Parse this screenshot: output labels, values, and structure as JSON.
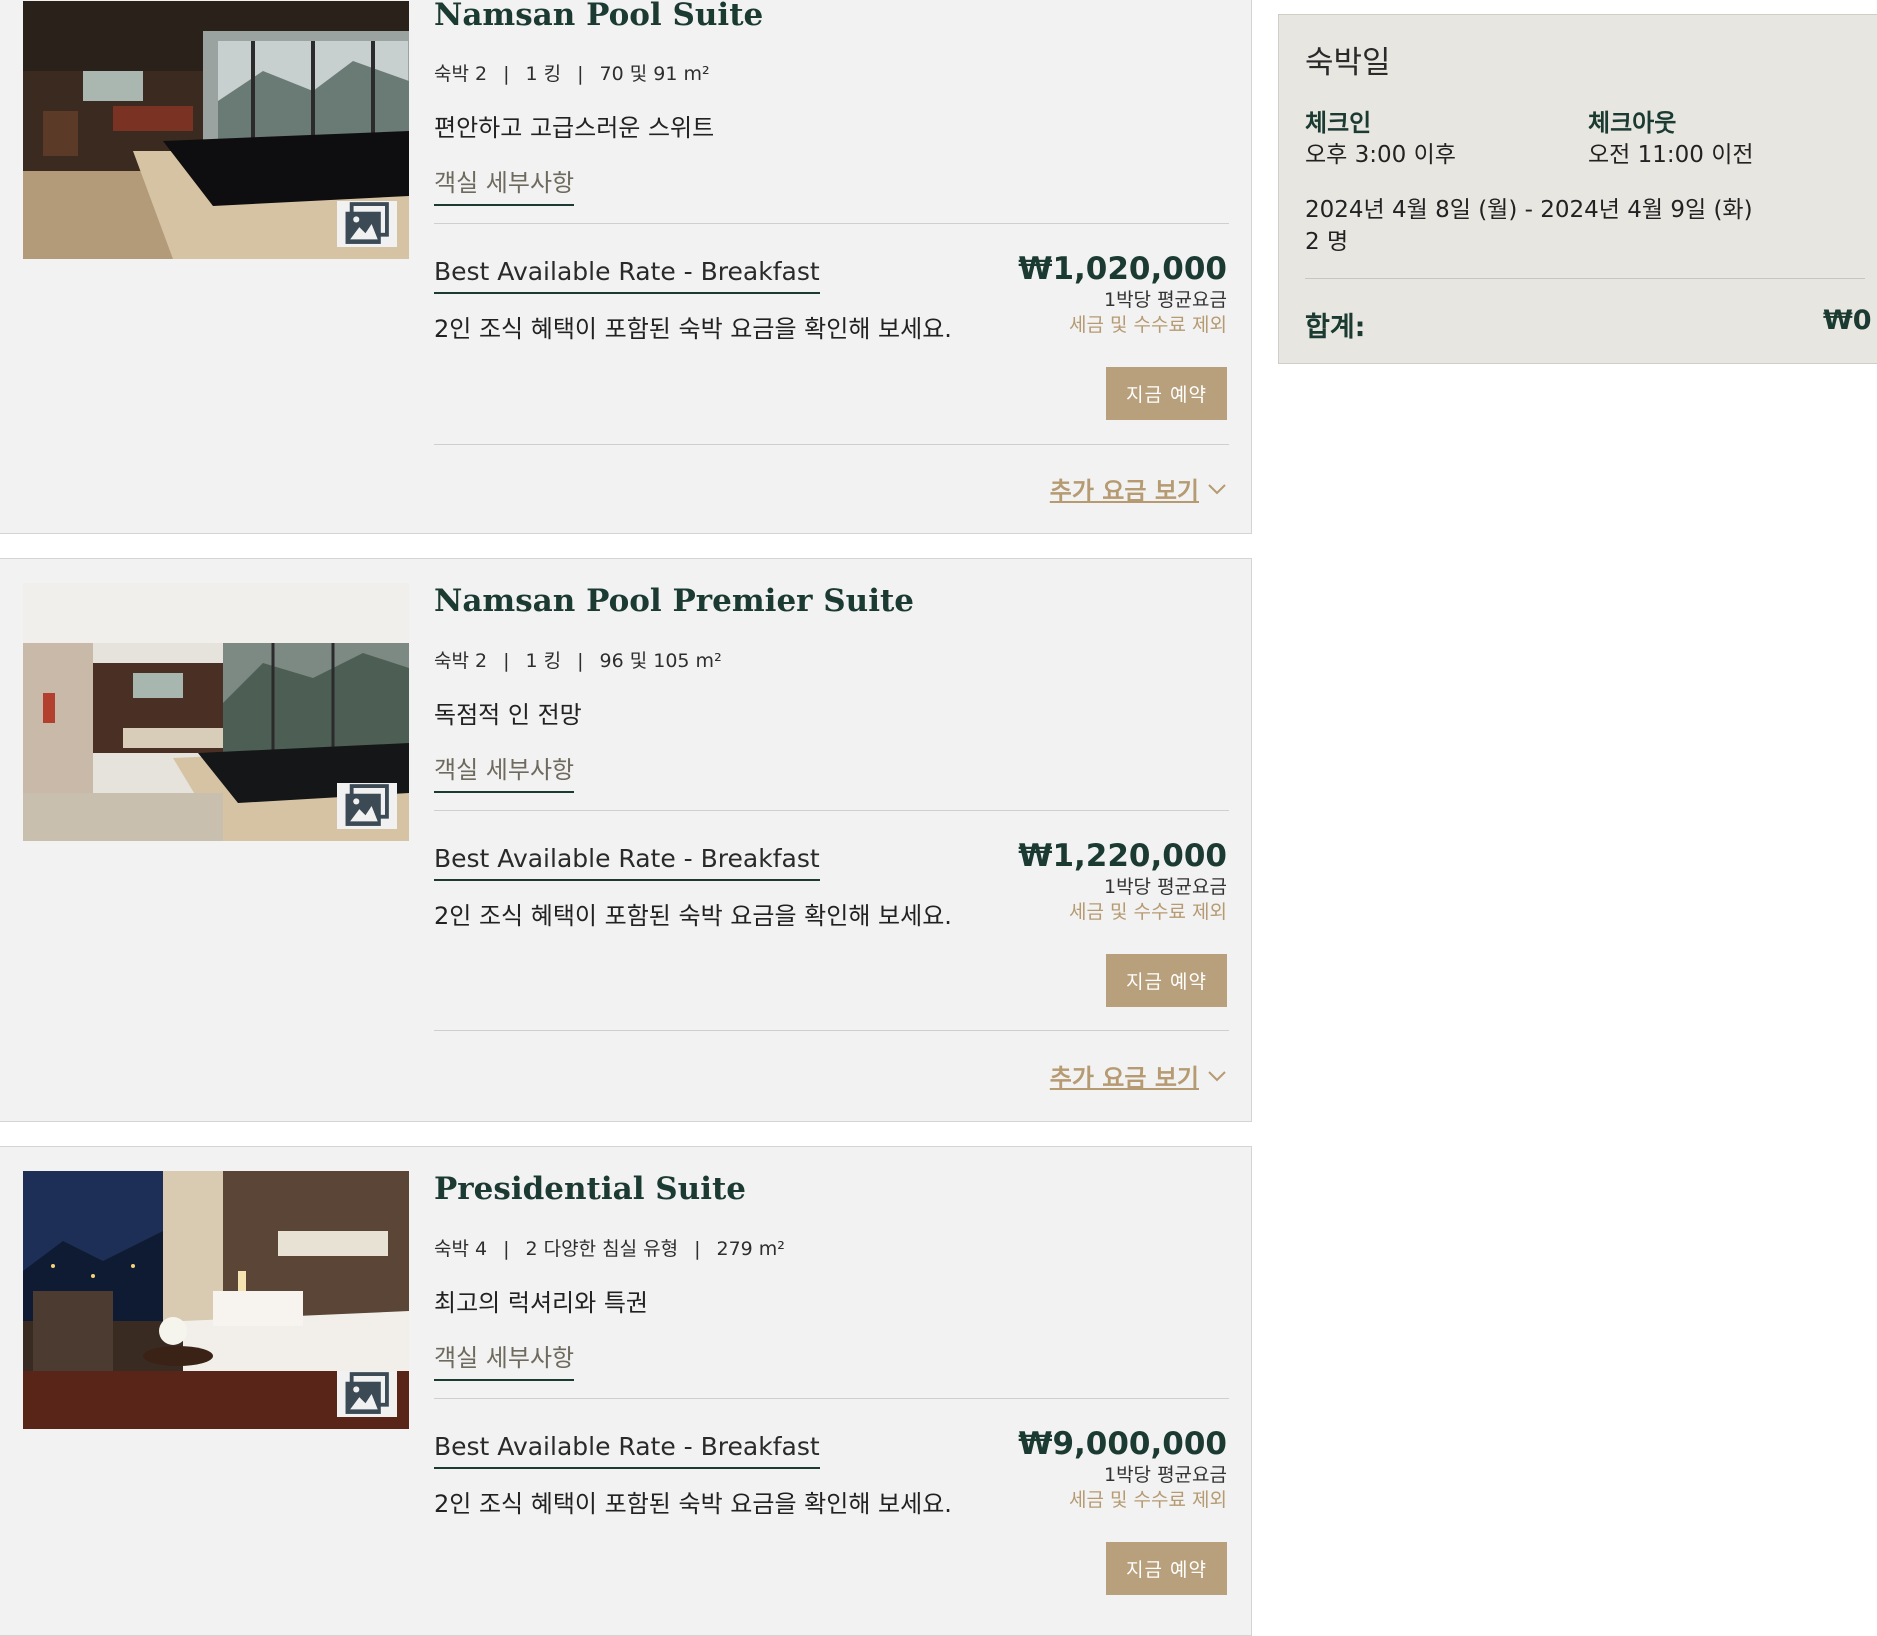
{
  "rooms": [
    {
      "title": "Namsan Pool Suite",
      "specs": [
        "숙박 2",
        "1 킹",
        "70 및 91 m²"
      ],
      "tagline": "편안하고 고급스러운 스위트",
      "details_link": "객실 세부사항",
      "rate_name": "Best Available Rate - Breakfast",
      "rate_desc": "2인 조식 혜택이 포함된 숙박 요금을 확인해 보세요.",
      "price": "₩1,020,000",
      "per_night": "1박당 평균요금",
      "tax_note": "세금 및 수수료 제외",
      "book_label": "지금 예약",
      "more_rates": "추가 요금 보기"
    },
    {
      "title": "Namsan Pool Premier Suite",
      "specs": [
        "숙박 2",
        "1 킹",
        "96 및 105 m²"
      ],
      "tagline": "독점적 인 전망",
      "details_link": "객실 세부사항",
      "rate_name": "Best Available Rate - Breakfast",
      "rate_desc": "2인 조식 혜택이 포함된 숙박 요금을 확인해 보세요.",
      "price": "₩1,220,000",
      "per_night": "1박당 평균요금",
      "tax_note": "세금 및 수수료 제외",
      "book_label": "지금 예약",
      "more_rates": "추가 요금 보기"
    },
    {
      "title": "Presidential Suite",
      "specs": [
        "숙박 4",
        "2 다양한 침실 유형",
        "279 m²"
      ],
      "tagline": "최고의 럭셔리와 특권",
      "details_link": "객실 세부사항",
      "rate_name": "Best Available Rate - Breakfast",
      "rate_desc": "2인 조식 혜택이 포함된 숙박 요금을 확인해 보세요.",
      "price": "₩9,000,000",
      "per_night": "1박당 평균요금",
      "tax_note": "세금 및 수수료 제외",
      "book_label": "지금 예약"
    }
  ],
  "summary": {
    "title": "숙박일",
    "checkin_label": "체크인",
    "checkin_time": "오후 3:00 이후",
    "checkout_label": "체크아웃",
    "checkout_time": "오전 11:00 이전",
    "dates": "2024년 4월 8일 (월) - 2024년 4월 9일 (화)",
    "guests": "2 명",
    "total_label": "합계:",
    "total_value": "₩0"
  },
  "colors": {
    "brand_green": "#1b3a31",
    "gold": "#b9a07c",
    "card_bg": "#f2f2f2",
    "summary_bg": "#e8e6e1"
  },
  "icons": {
    "gallery": "image-gallery-icon",
    "expand": "chevron-down-icon"
  }
}
